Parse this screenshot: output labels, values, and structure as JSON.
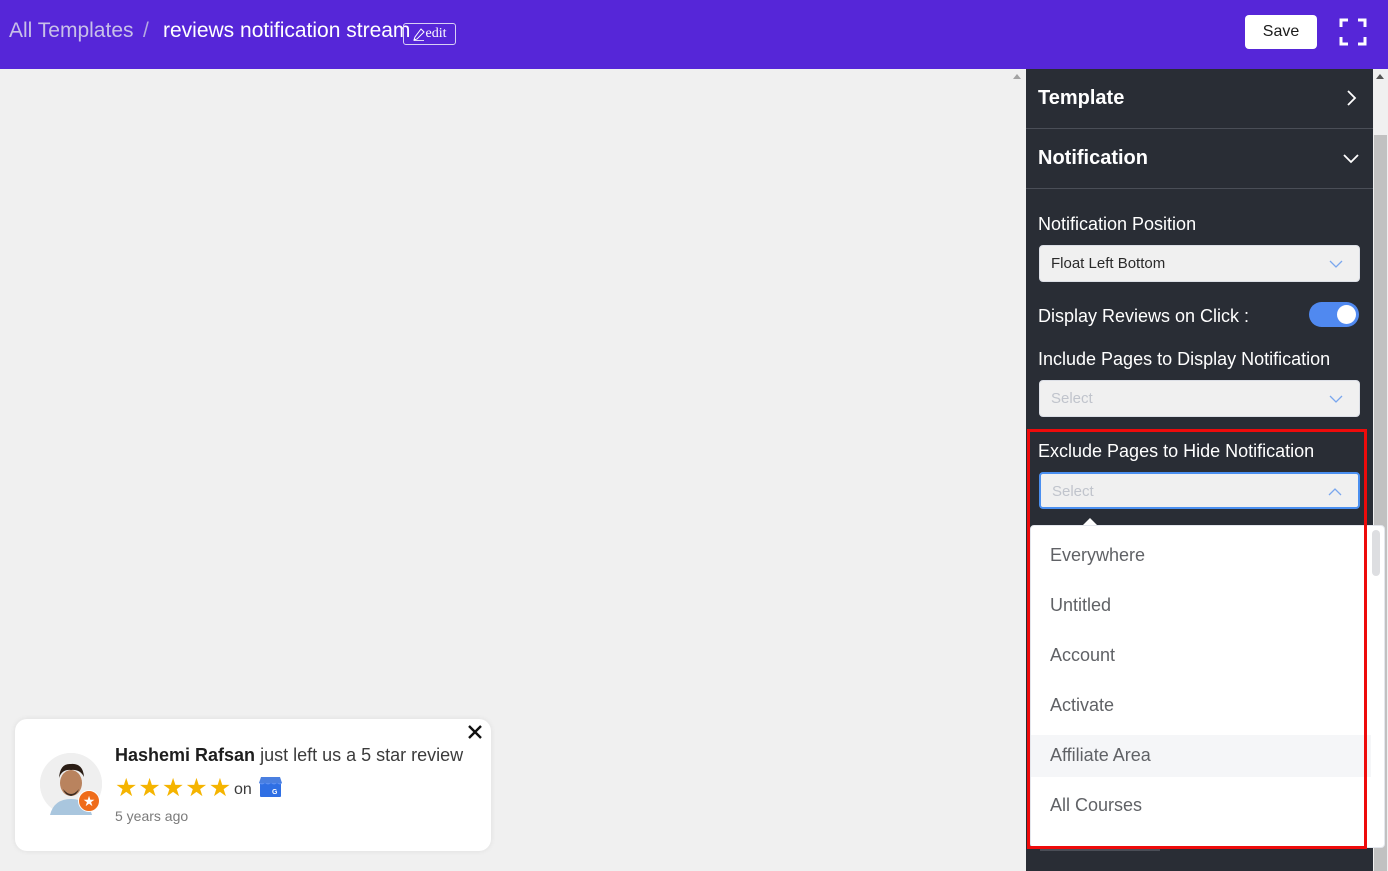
{
  "header": {
    "breadcrumb_root": "All Templates",
    "breadcrumb_separator": "/",
    "template_name": "reviews notification stream",
    "edit_label": "edit",
    "save_label": "Save",
    "brand_color": "#5626d8"
  },
  "preview": {
    "reviewer_name": "Hashemi Rafsan",
    "message": "just left us a 5 star review",
    "rating": 5,
    "max_rating": 5,
    "on_label": "on",
    "platform_icon": "google-my-business-icon",
    "time_ago": "5 years ago"
  },
  "panel": {
    "sections": [
      {
        "title": "Template",
        "expanded": false
      },
      {
        "title": "Notification",
        "expanded": true
      }
    ],
    "notification_position": {
      "label": "Notification Position",
      "value": "Float Left Bottom"
    },
    "display_reviews_on_click": {
      "label": "Display Reviews on Click :",
      "enabled": true,
      "accent_color": "#5089f0"
    },
    "include_pages": {
      "label": "Include Pages to Display Notification",
      "placeholder": "Select"
    },
    "exclude_pages": {
      "label": "Exclude Pages to Hide Notification",
      "placeholder": "Select",
      "open": true,
      "options": [
        "Everywhere",
        "Untitled",
        "Account",
        "Activate",
        "Affiliate Area",
        "All Courses"
      ],
      "hovered_option": "Affiliate Area"
    },
    "highlight_color": "#ee0b0b"
  }
}
